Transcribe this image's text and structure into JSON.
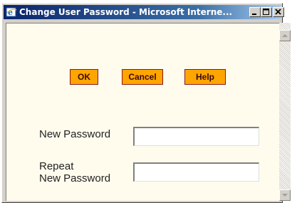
{
  "window": {
    "title": "Change User Password - Microsoft Interne...",
    "icon": "ie-icon",
    "controls": [
      "minimize",
      "maximize",
      "close"
    ]
  },
  "buttons": {
    "ok": "OK",
    "cancel": "Cancel",
    "help": "Help"
  },
  "form": {
    "new_password_label": "New Password",
    "repeat_label_line1": "Repeat",
    "repeat_label_line2": "New Password",
    "new_password_value": "",
    "repeat_password_value": ""
  },
  "colors": {
    "background": "#fffcee",
    "button_fill": "#ffa500",
    "button_border": "#8b1a1a",
    "titlebar": "#0a246a"
  }
}
